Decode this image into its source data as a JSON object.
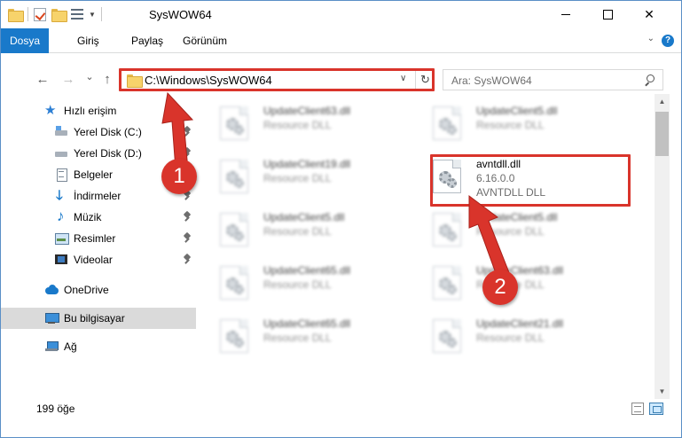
{
  "window": {
    "title": "SysWOW64",
    "close_glyph": "✕"
  },
  "ribbon": {
    "tabs": [
      {
        "label": "Dosya",
        "active": true
      },
      {
        "label": "Giriş"
      },
      {
        "label": "Paylaş"
      },
      {
        "label": "Görünüm"
      }
    ],
    "help": "?"
  },
  "nav": {
    "back": "←",
    "forward": "→",
    "recent": "⌄",
    "up": "↑",
    "address": "C:\\Windows\\SysWOW64",
    "refresh": "↻",
    "search_placeholder": "Ara: SysWOW64"
  },
  "sidebar": {
    "items": [
      {
        "label": "Hızlı erişim",
        "icon": "star-icon"
      },
      {
        "label": "Yerel Disk (C:)",
        "icon": "drive-icon",
        "pinned": true
      },
      {
        "label": "Yerel Disk (D:)",
        "icon": "drive-icon",
        "pinned": true
      },
      {
        "label": "Belgeler",
        "icon": "documents-icon",
        "pinned": true
      },
      {
        "label": "İndirmeler",
        "icon": "download-icon",
        "pinned": true
      },
      {
        "label": "Müzik",
        "icon": "music-icon",
        "pinned": true
      },
      {
        "label": "Resimler",
        "icon": "pictures-icon",
        "pinned": true
      },
      {
        "label": "Videolar",
        "icon": "video-icon",
        "pinned": true
      },
      {
        "label": "OneDrive",
        "icon": "cloud-icon"
      },
      {
        "label": "Bu bilgisayar",
        "icon": "computer-icon",
        "selected": true
      },
      {
        "label": "Ağ",
        "icon": "network-icon"
      }
    ]
  },
  "files": [
    {
      "name": "UpdateClient63.dll",
      "type": "Resource DLL",
      "blurred": true
    },
    {
      "name": "UpdateClient5.dll",
      "type": "Resource DLL",
      "blurred": true
    },
    {
      "name": "UpdateClient19.dll",
      "type": "Resource DLL",
      "blurred": true
    },
    {
      "name": "avntdll.dll",
      "type": "6.16.0.0",
      "extra": "AVNTDLL DLL",
      "blurred": false,
      "highlighted": true
    },
    {
      "name": "UpdateClient5.dll",
      "type": "Resource DLL",
      "blurred": true
    },
    {
      "name": "UpdateClient5.dll",
      "type": "Resource DLL",
      "blurred": true
    },
    {
      "name": "UpdateClient65.dll",
      "type": "Resource DLL",
      "blurred": true
    },
    {
      "name": "UpdateClient63.dll",
      "type": "Resource DLL",
      "blurred": true
    },
    {
      "name": "UpdateClient65.dll",
      "type": "Resource DLL",
      "blurred": true
    },
    {
      "name": "UpdateClient21.dll",
      "type": "Resource DLL",
      "blurred": true
    }
  ],
  "status": {
    "item_count": "199 öğe"
  },
  "annotations": {
    "step1": "1",
    "step2": "2",
    "color": "#d9342b"
  }
}
